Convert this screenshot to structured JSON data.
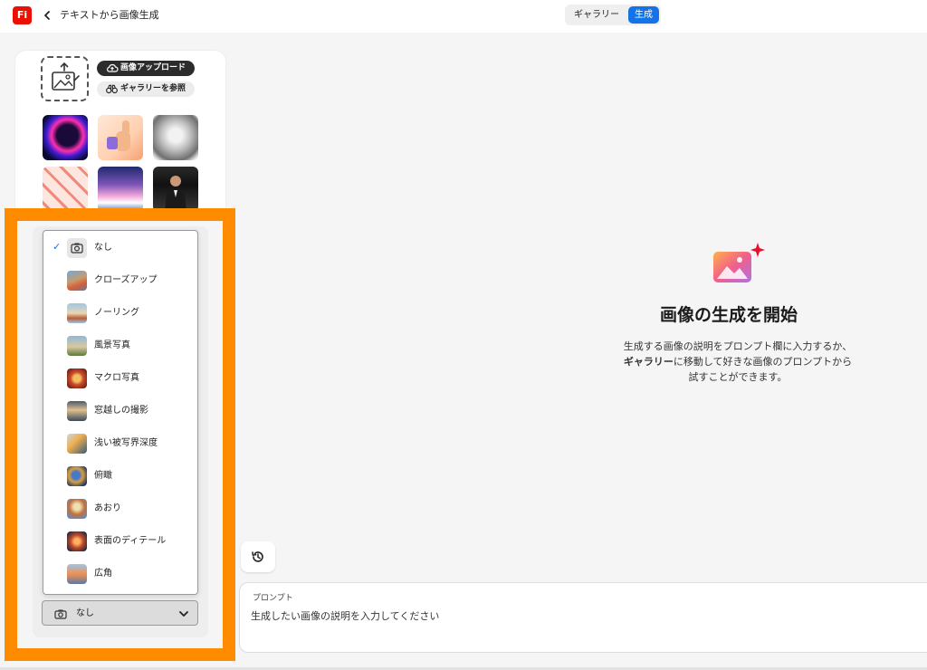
{
  "app": {
    "logo_text": "Fi",
    "page_title": "テキストから画像生成"
  },
  "mode_tabs": {
    "gallery_label": "ギャラリー",
    "generate_label": "生成",
    "active": "生成"
  },
  "upload": {
    "upload_button_label": "画像アップロード",
    "browse_button_label": "ギャラリーを参照"
  },
  "composition_menu": {
    "selected": "なし",
    "items": [
      {
        "label": "なし",
        "icon": "camera-icon",
        "checked": true
      },
      {
        "label": "クローズアップ",
        "icon": "balloon-thumb"
      },
      {
        "label": "ノーリング",
        "icon": "balloon-thumb"
      },
      {
        "label": "風景写真",
        "icon": "balloon-thumb"
      },
      {
        "label": "マクロ写真",
        "icon": "balloon-thumb"
      },
      {
        "label": "窓越しの撮影",
        "icon": "balloon-thumb"
      },
      {
        "label": "浅い被写界深度",
        "icon": "balloon-thumb"
      },
      {
        "label": "俯瞰",
        "icon": "balloon-thumb"
      },
      {
        "label": "あおり",
        "icon": "balloon-thumb"
      },
      {
        "label": "表面のディテール",
        "icon": "balloon-thumb"
      },
      {
        "label": "広角",
        "icon": "balloon-thumb"
      }
    ]
  },
  "composition_select": {
    "value": "なし"
  },
  "empty_state": {
    "title": "画像の生成を開始",
    "line1": "生成する画像の説明をプロンプト欄に入力するか、",
    "line2_bold": "ギャラリー",
    "line2_rest": "に移動して好きな画像のプロンプトから",
    "line3": "試すことができます。"
  },
  "prompt": {
    "label": "プロンプト",
    "placeholder": "生成したい画像の説明を入力してください",
    "value": ""
  },
  "colors": {
    "accent": "#1473e6",
    "brand": "#eb1000",
    "highlight": "#ff8c00"
  }
}
